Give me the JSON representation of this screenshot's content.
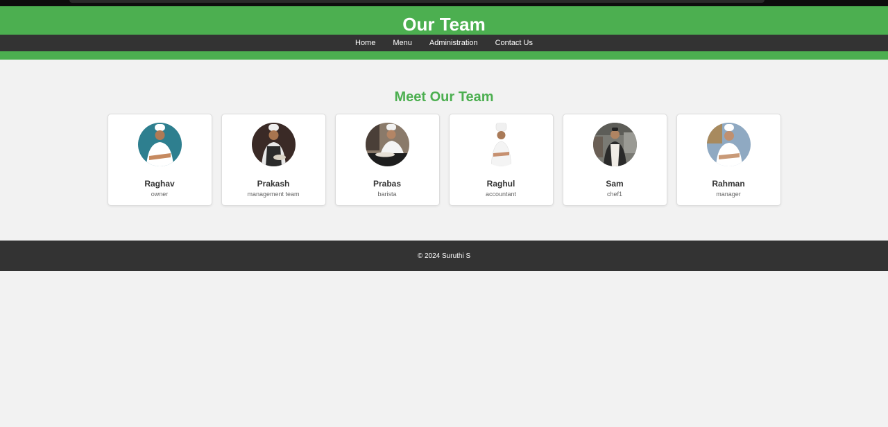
{
  "header": {
    "title": "Our Team",
    "nav": [
      "Home",
      "Menu",
      "Administration",
      "Contact Us"
    ]
  },
  "main": {
    "section_title": "Meet Our Team",
    "members": [
      {
        "name": "Raghav",
        "role": "owner",
        "bg": "#2e7f8f"
      },
      {
        "name": "Prakash",
        "role": "management team",
        "bg": "#3a2a26"
      },
      {
        "name": "Prabas",
        "role": "barista",
        "bg": "#8a7a6a"
      },
      {
        "name": "Raghul",
        "role": "accountant",
        "bg": "#ffffff"
      },
      {
        "name": "Sam",
        "role": "chef1",
        "bg": "#7a7a74"
      },
      {
        "name": "Rahman",
        "role": "manager",
        "bg": "#8fa9c2"
      }
    ]
  },
  "footer": {
    "copyright": "© 2024 Suruthi S"
  },
  "colors": {
    "accent": "#4caf50",
    "dark": "#333333",
    "page_bg": "#f2f2f2"
  }
}
